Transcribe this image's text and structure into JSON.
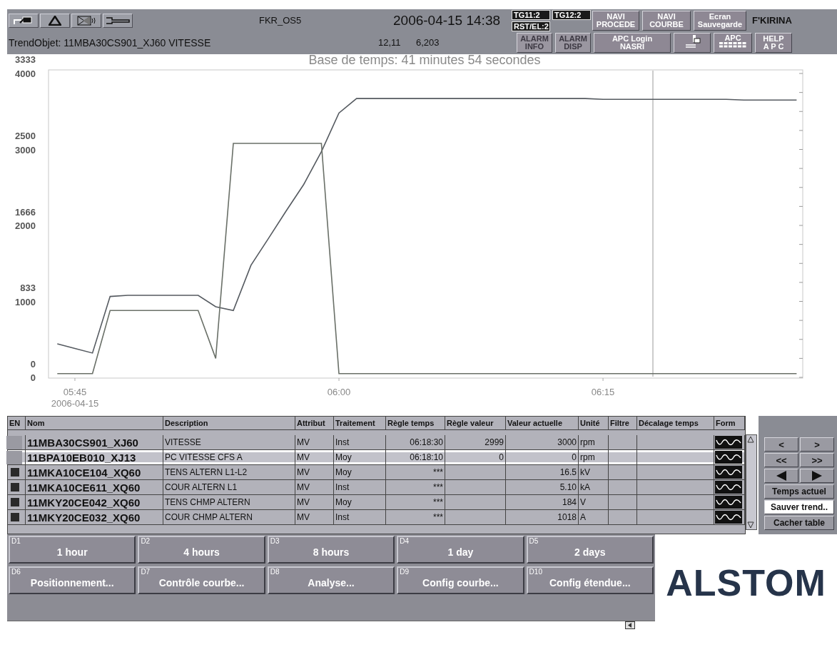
{
  "header": {
    "station": "FKR_OS5",
    "datetime": "2006-04-15 14:38",
    "status_tags": [
      {
        "label": "TG11:2"
      },
      {
        "label": "TG12:2"
      },
      {
        "label": "RST/EL:2"
      }
    ],
    "nav_buttons": [
      {
        "label": "NAVI\nPROCEDE"
      },
      {
        "label": "NAVI\nCOURBE"
      },
      {
        "label": "Ecran\nSauvegarde"
      }
    ],
    "user": "F'KIRINA",
    "trend_object": "TrendObjet: 11MBA30CS901_XJ60 VITESSE",
    "readouts": [
      "12,11",
      "6,203"
    ],
    "alarm_buttons": [
      {
        "label": "ALARM\nINFO",
        "disabled": true
      },
      {
        "label": "ALARM\nDISP",
        "disabled": true
      }
    ],
    "tool_buttons": [
      {
        "kind": "text",
        "label": "APC Login\nNASRI"
      },
      {
        "kind": "icon"
      },
      {
        "kind": "apc",
        "label": "APC"
      },
      {
        "kind": "text",
        "label": "HELP\nA P C"
      }
    ]
  },
  "trend": {
    "secondary_scale_labels": [
      "3333",
      "2500",
      "1666",
      "833",
      "0"
    ],
    "date_label": "2006-04-15",
    "chart_data": {
      "type": "line",
      "title": "Base de temps: 41 minutes 54 secondes",
      "categories": [
        null,
        "05:45",
        null,
        null,
        null,
        null,
        null,
        null,
        null,
        null,
        null,
        null,
        null,
        null,
        null,
        null,
        "06:00",
        null,
        null,
        null,
        null,
        null,
        null,
        null,
        null,
        null,
        null,
        null,
        null,
        null,
        null,
        "06:15",
        null,
        null,
        null,
        null,
        null,
        null,
        null,
        null,
        null,
        null,
        null
      ],
      "series": [
        {
          "color": "#555a60",
          "values": [
            440,
            380,
            320,
            1065,
            1080,
            1080,
            1080,
            1080,
            1080,
            930,
            880,
            1475,
            1830,
            2190,
            2540,
            2970,
            3480,
            3670,
            3670,
            3670,
            3670,
            3670,
            3670,
            3670,
            3670,
            3670,
            3670,
            3670,
            3670,
            3670,
            3670,
            3660,
            3660,
            3660,
            3660,
            3660,
            3660,
            3660,
            3660,
            3650,
            3650,
            3650,
            3650
          ]
        },
        {
          "color": "#6a7068",
          "values": [
            50,
            50,
            50,
            880,
            880,
            880,
            880,
            880,
            880,
            250,
            3080,
            3080,
            3080,
            3080,
            3080,
            3080,
            50,
            50,
            50,
            50,
            50,
            50,
            50,
            50,
            50,
            50,
            50,
            50,
            50,
            50,
            50,
            50,
            50,
            50,
            50,
            50,
            50,
            50,
            50,
            50,
            50,
            50,
            50
          ]
        }
      ],
      "ylim": [
        0,
        4000
      ],
      "yticks": [
        0,
        1000,
        2000,
        3000,
        4000
      ]
    }
  },
  "table": {
    "columns": [
      "EN",
      "Nom",
      "Description",
      "Attribut",
      "Traitement",
      "Règle temps",
      "Règle valeur",
      "Valeur actuelle",
      "Unité",
      "Filtre",
      "Décalage temps",
      "Form"
    ],
    "rows": [
      {
        "en_marked": false,
        "selected": false,
        "nom": "11MBA30CS901_XJ60",
        "description": "VITESSE",
        "attribut": "MV",
        "traitement": "Inst",
        "regle_temps": "06:18:30",
        "regle_valeur": "2999",
        "valeur_actuelle": "3000",
        "unite": "rpm"
      },
      {
        "en_marked": false,
        "selected": true,
        "nom": "11BPA10EB010_XJ13",
        "description": "PC VITESSE CFS A",
        "attribut": "MV",
        "traitement": "Moy",
        "regle_temps": "06:18:10",
        "regle_valeur": "0",
        "valeur_actuelle": "0",
        "unite": "rpm"
      },
      {
        "en_marked": true,
        "selected": false,
        "nom": "11MKA10CE104_XQ60",
        "description": "TENS ALTERN L1-L2",
        "attribut": "MV",
        "traitement": "Moy",
        "regle_temps": "***",
        "valeur_actuelle": "16.5",
        "unite": "kV"
      },
      {
        "en_marked": true,
        "selected": false,
        "nom": "11MKA10CE611_XQ60",
        "description": "COUR ALTERN L1",
        "attribut": "MV",
        "traitement": "Inst",
        "regle_temps": "***",
        "valeur_actuelle": "5.10",
        "unite": "kA"
      },
      {
        "en_marked": true,
        "selected": false,
        "nom": "11MKY20CE042_XQ60",
        "description": "TENS CHMP ALTERN",
        "attribut": "MV",
        "traitement": "Moy",
        "regle_temps": "***",
        "valeur_actuelle": "184",
        "unite": "V"
      },
      {
        "en_marked": true,
        "selected": false,
        "nom": "11MKY20CE032_XQ60",
        "description": "COUR CHMP ALTERN",
        "attribut": "MV",
        "traitement": "Inst",
        "regle_temps": "***",
        "valeur_actuelle": "1018",
        "unite": "A"
      }
    ]
  },
  "time_nav": {
    "step_buttons": [
      "<",
      ">",
      "<<",
      ">>"
    ],
    "action_buttons": [
      {
        "label": "Temps actuel",
        "highlighted": false
      },
      {
        "label": "Sauver trend..",
        "highlighted": true
      },
      {
        "label": "Cacher table",
        "highlighted": false
      }
    ]
  },
  "function_keys": [
    {
      "key": "D1",
      "label": "1 hour"
    },
    {
      "key": "D2",
      "label": "4 hours"
    },
    {
      "key": "D3",
      "label": "8 hours"
    },
    {
      "key": "D4",
      "label": "1 day"
    },
    {
      "key": "D5",
      "label": "2 days"
    },
    {
      "key": "D6",
      "label": "Positionnement..."
    },
    {
      "key": "D7",
      "label": "Contrôle courbe..."
    },
    {
      "key": "D8",
      "label": "Analyse..."
    },
    {
      "key": "D9",
      "label": "Config courbe..."
    },
    {
      "key": "D10",
      "label": "Config étendue..."
    }
  ],
  "logo": "ALSTOM"
}
